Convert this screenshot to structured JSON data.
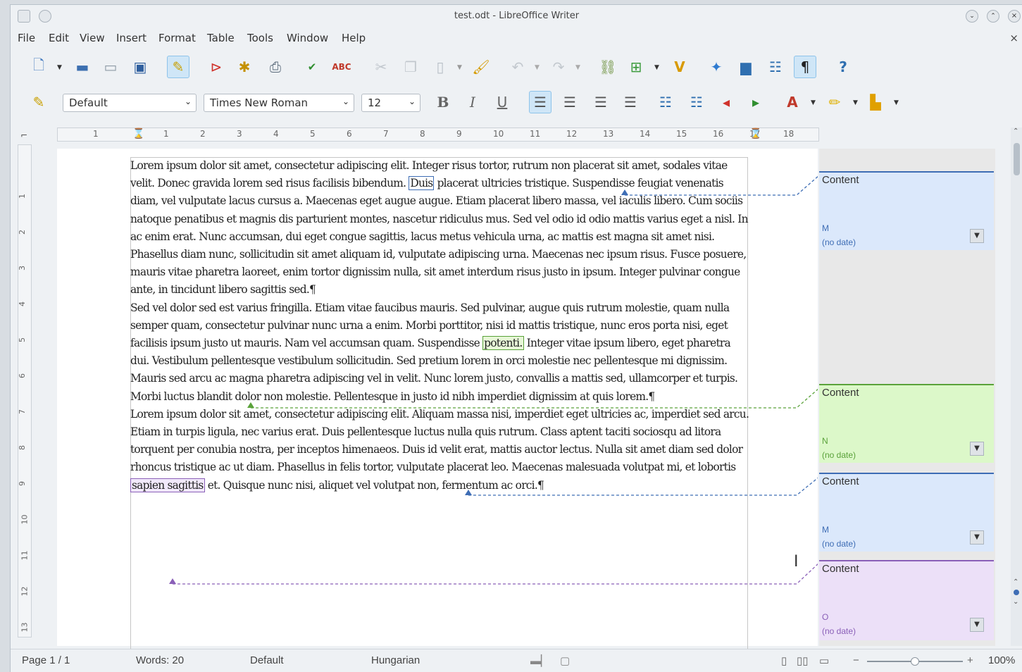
{
  "window": {
    "title": "test.odt - LibreOffice Writer"
  },
  "menu": [
    "File",
    "Edit",
    "View",
    "Insert",
    "Format",
    "Table",
    "Tools",
    "Window",
    "Help"
  ],
  "formatting": {
    "paragraph_style": "Default",
    "font_name": "Times New Roman",
    "font_size": "12"
  },
  "ruler": {
    "h_numbers": [
      "1",
      "1",
      "2",
      "3",
      "4",
      "5",
      "6",
      "7",
      "8",
      "9",
      "10",
      "11",
      "12",
      "13",
      "14",
      "15",
      "16",
      "17",
      "18"
    ],
    "v_numbers": [
      "1",
      "2",
      "3",
      "4",
      "5",
      "6",
      "7",
      "8",
      "9",
      "10",
      "11",
      "12",
      "13"
    ]
  },
  "document": {
    "p1_a": "Lorem ipsum dolor sit amet, consectetur adipiscing elit. Integer risus tortor, rutrum non placerat sit amet, sodales vitae velit. Donec gravida lorem sed risus facilisis bibendum. ",
    "p1_hl": "Duis",
    "p1_b": " placerat ultricies tristique. Suspendisse feugiat venenatis diam, vel vulputate lacus cursus a. Maecenas eget augue augue. Etiam placerat libero massa, vel iaculis libero. Cum sociis natoque penatibus et magnis dis parturient montes, nascetur ridiculus mus. Sed vel odio id odio mattis varius eget a nisl. In ac enim erat. Nunc accumsan, dui eget congue sagittis, lacus metus vehicula urna, ac mattis est magna sit amet nisi. Phasellus diam nunc, sollicitudin sit amet aliquam id, vulputate adipiscing urna. Maecenas nec ipsum risus. Fusce posuere, mauris vitae pharetra laoreet, enim tortor dignissim nulla, sit amet interdum risus justo in ipsum. Integer pulvinar congue ante, in tincidunt libero sagittis sed.¶",
    "p2_a": "Sed vel dolor sed est varius fringilla. Etiam vitae faucibus mauris. Sed pulvinar, augue quis rutrum molestie, quam nulla semper quam, consectetur pulvinar nunc urna a enim. Morbi porttitor, nisi id mattis tristique, nunc eros porta nisi, eget facilisis ipsum justo ut mauris. Nam vel accumsan quam. Suspendisse ",
    "p2_hl": "potenti.",
    "p2_b": " Integer vitae ipsum libero, eget pharetra dui. Vestibulum pellentesque vestibulum sollicitudin. Sed pretium lorem in orci molestie nec pellentesque mi dignissim. Mauris sed arcu ac magna pharetra adipiscing vel in velit. Nunc lorem justo, convallis a mattis sed, ullamcorper et turpis. Morbi luctus blandit dolor non molestie. Pellentesque in justo id nibh imperdiet dignissim at quis lorem.¶",
    "p3_a": "Lorem ipsum dolor sit amet, consectetur adipiscing elit. Aliquam massa nisi, imperdiet eget ultricies ac, imperdiet sed arcu. Etiam in turpis ligula, nec varius erat. Duis pellentesque luctus nulla quis rutrum. Class aptent taciti sociosqu ad litora torquent per conubia nostra, per inceptos himenaeos. Duis id velit erat, mattis auctor lectus. Nulla sit amet diam sed dolor rhoncus tristique ac ut diam. Phasellus in felis tortor, vulputate placerat leo. Maecenas malesuada volutpat mi, et lobortis ",
    "p3_hl": "sapien sagittis",
    "p3_b": " et. Quisque nunc nisi, aliquet vel volutpat non, fermentum ac orci.¶"
  },
  "comments": [
    {
      "text": "Content",
      "author": "M",
      "date": "(no date)",
      "color": "#dbe8fb",
      "border": "#3e6db5"
    },
    {
      "text": "Content",
      "author": "N",
      "date": "(no date)",
      "color": "#dcf8c9",
      "border": "#5aa23a"
    },
    {
      "text": "Content",
      "author": "M",
      "date": "(no date)",
      "color": "#dbe8fb",
      "border": "#3e6db5"
    },
    {
      "text": "Content",
      "author": "O",
      "date": "(no date)",
      "color": "#ece0f8",
      "border": "#8a5fb8"
    }
  ],
  "status": {
    "page": "Page 1 / 1",
    "words": "Words: 20",
    "page_style": "Default",
    "language": "Hungarian",
    "zoom": "100%"
  }
}
